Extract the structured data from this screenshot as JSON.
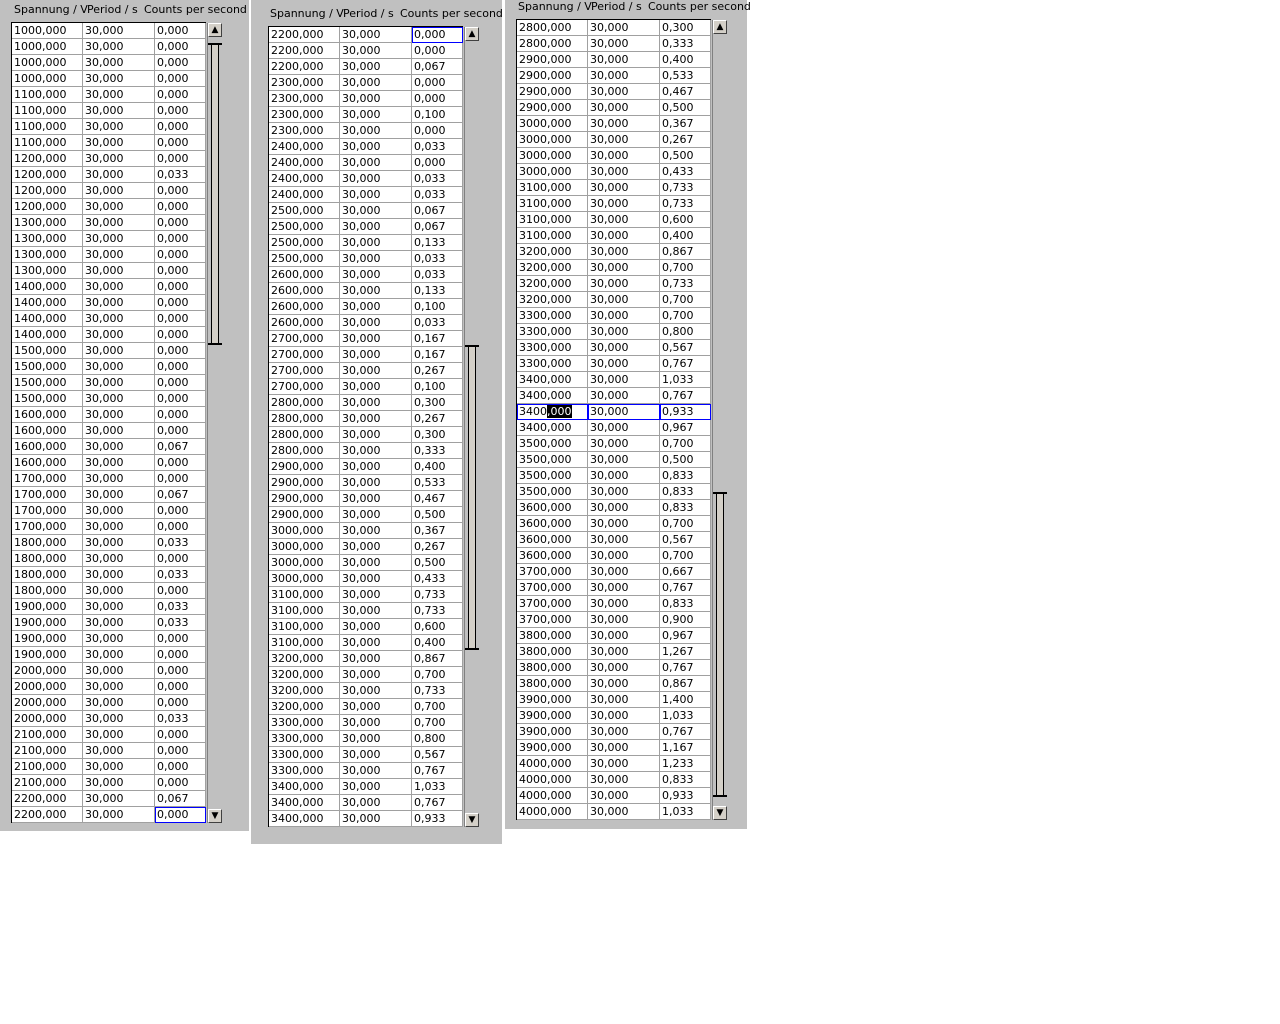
{
  "columns": [
    "Spannung / V",
    "Period / s",
    "Counts per second"
  ],
  "tables": [
    {
      "rows": [
        [
          "1000,000",
          "30,000",
          "0,000"
        ],
        [
          "1000,000",
          "30,000",
          "0,000"
        ],
        [
          "1000,000",
          "30,000",
          "0,000"
        ],
        [
          "1000,000",
          "30,000",
          "0,000"
        ],
        [
          "1100,000",
          "30,000",
          "0,000"
        ],
        [
          "1100,000",
          "30,000",
          "0,000"
        ],
        [
          "1100,000",
          "30,000",
          "0,000"
        ],
        [
          "1100,000",
          "30,000",
          "0,000"
        ],
        [
          "1200,000",
          "30,000",
          "0,000"
        ],
        [
          "1200,000",
          "30,000",
          "0,033"
        ],
        [
          "1200,000",
          "30,000",
          "0,000"
        ],
        [
          "1200,000",
          "30,000",
          "0,000"
        ],
        [
          "1300,000",
          "30,000",
          "0,000"
        ],
        [
          "1300,000",
          "30,000",
          "0,000"
        ],
        [
          "1300,000",
          "30,000",
          "0,000"
        ],
        [
          "1300,000",
          "30,000",
          "0,000"
        ],
        [
          "1400,000",
          "30,000",
          "0,000"
        ],
        [
          "1400,000",
          "30,000",
          "0,000"
        ],
        [
          "1400,000",
          "30,000",
          "0,000"
        ],
        [
          "1400,000",
          "30,000",
          "0,000"
        ],
        [
          "1500,000",
          "30,000",
          "0,000"
        ],
        [
          "1500,000",
          "30,000",
          "0,000"
        ],
        [
          "1500,000",
          "30,000",
          "0,000"
        ],
        [
          "1500,000",
          "30,000",
          "0,000"
        ],
        [
          "1600,000",
          "30,000",
          "0,000"
        ],
        [
          "1600,000",
          "30,000",
          "0,000"
        ],
        [
          "1600,000",
          "30,000",
          "0,067"
        ],
        [
          "1600,000",
          "30,000",
          "0,000"
        ],
        [
          "1700,000",
          "30,000",
          "0,000"
        ],
        [
          "1700,000",
          "30,000",
          "0,067"
        ],
        [
          "1700,000",
          "30,000",
          "0,000"
        ],
        [
          "1700,000",
          "30,000",
          "0,000"
        ],
        [
          "1800,000",
          "30,000",
          "0,033"
        ],
        [
          "1800,000",
          "30,000",
          "0,000"
        ],
        [
          "1800,000",
          "30,000",
          "0,033"
        ],
        [
          "1800,000",
          "30,000",
          "0,000"
        ],
        [
          "1900,000",
          "30,000",
          "0,033"
        ],
        [
          "1900,000",
          "30,000",
          "0,033"
        ],
        [
          "1900,000",
          "30,000",
          "0,000"
        ],
        [
          "1900,000",
          "30,000",
          "0,000"
        ],
        [
          "2000,000",
          "30,000",
          "0,000"
        ],
        [
          "2000,000",
          "30,000",
          "0,000"
        ],
        [
          "2000,000",
          "30,000",
          "0,000"
        ],
        [
          "2000,000",
          "30,000",
          "0,033"
        ],
        [
          "2100,000",
          "30,000",
          "0,000"
        ],
        [
          "2100,000",
          "30,000",
          "0,000"
        ],
        [
          "2100,000",
          "30,000",
          "0,000"
        ],
        [
          "2100,000",
          "30,000",
          "0,000"
        ],
        [
          "2200,000",
          "30,000",
          "0,067"
        ],
        [
          "2200,000",
          "30,000",
          "0,000"
        ]
      ],
      "selected_row": 49
    },
    {
      "rows": [
        [
          "2200,000",
          "30,000",
          "0,000"
        ],
        [
          "2200,000",
          "30,000",
          "0,000"
        ],
        [
          "2200,000",
          "30,000",
          "0,067"
        ],
        [
          "2300,000",
          "30,000",
          "0,000"
        ],
        [
          "2300,000",
          "30,000",
          "0,000"
        ],
        [
          "2300,000",
          "30,000",
          "0,100"
        ],
        [
          "2300,000",
          "30,000",
          "0,000"
        ],
        [
          "2400,000",
          "30,000",
          "0,033"
        ],
        [
          "2400,000",
          "30,000",
          "0,000"
        ],
        [
          "2400,000",
          "30,000",
          "0,033"
        ],
        [
          "2400,000",
          "30,000",
          "0,033"
        ],
        [
          "2500,000",
          "30,000",
          "0,067"
        ],
        [
          "2500,000",
          "30,000",
          "0,067"
        ],
        [
          "2500,000",
          "30,000",
          "0,133"
        ],
        [
          "2500,000",
          "30,000",
          "0,033"
        ],
        [
          "2600,000",
          "30,000",
          "0,033"
        ],
        [
          "2600,000",
          "30,000",
          "0,133"
        ],
        [
          "2600,000",
          "30,000",
          "0,100"
        ],
        [
          "2600,000",
          "30,000",
          "0,033"
        ],
        [
          "2700,000",
          "30,000",
          "0,167"
        ],
        [
          "2700,000",
          "30,000",
          "0,167"
        ],
        [
          "2700,000",
          "30,000",
          "0,267"
        ],
        [
          "2700,000",
          "30,000",
          "0,100"
        ],
        [
          "2800,000",
          "30,000",
          "0,300"
        ],
        [
          "2800,000",
          "30,000",
          "0,267"
        ],
        [
          "2800,000",
          "30,000",
          "0,300"
        ],
        [
          "2800,000",
          "30,000",
          "0,333"
        ],
        [
          "2900,000",
          "30,000",
          "0,400"
        ],
        [
          "2900,000",
          "30,000",
          "0,533"
        ],
        [
          "2900,000",
          "30,000",
          "0,467"
        ],
        [
          "2900,000",
          "30,000",
          "0,500"
        ],
        [
          "3000,000",
          "30,000",
          "0,367"
        ],
        [
          "3000,000",
          "30,000",
          "0,267"
        ],
        [
          "3000,000",
          "30,000",
          "0,500"
        ],
        [
          "3000,000",
          "30,000",
          "0,433"
        ],
        [
          "3100,000",
          "30,000",
          "0,733"
        ],
        [
          "3100,000",
          "30,000",
          "0,733"
        ],
        [
          "3100,000",
          "30,000",
          "0,600"
        ],
        [
          "3100,000",
          "30,000",
          "0,400"
        ],
        [
          "3200,000",
          "30,000",
          "0,867"
        ],
        [
          "3200,000",
          "30,000",
          "0,700"
        ],
        [
          "3200,000",
          "30,000",
          "0,733"
        ],
        [
          "3200,000",
          "30,000",
          "0,700"
        ],
        [
          "3300,000",
          "30,000",
          "0,700"
        ],
        [
          "3300,000",
          "30,000",
          "0,800"
        ],
        [
          "3300,000",
          "30,000",
          "0,567"
        ],
        [
          "3300,000",
          "30,000",
          "0,767"
        ],
        [
          "3400,000",
          "30,000",
          "1,033"
        ],
        [
          "3400,000",
          "30,000",
          "0,767"
        ],
        [
          "3400,000",
          "30,000",
          "0,933"
        ]
      ],
      "selected_row": 0
    },
    {
      "rows": [
        [
          "2800,000",
          "30,000",
          "0,300"
        ],
        [
          "2800,000",
          "30,000",
          "0,333"
        ],
        [
          "2900,000",
          "30,000",
          "0,400"
        ],
        [
          "2900,000",
          "30,000",
          "0,533"
        ],
        [
          "2900,000",
          "30,000",
          "0,467"
        ],
        [
          "2900,000",
          "30,000",
          "0,500"
        ],
        [
          "3000,000",
          "30,000",
          "0,367"
        ],
        [
          "3000,000",
          "30,000",
          "0,267"
        ],
        [
          "3000,000",
          "30,000",
          "0,500"
        ],
        [
          "3000,000",
          "30,000",
          "0,433"
        ],
        [
          "3100,000",
          "30,000",
          "0,733"
        ],
        [
          "3100,000",
          "30,000",
          "0,733"
        ],
        [
          "3100,000",
          "30,000",
          "0,600"
        ],
        [
          "3100,000",
          "30,000",
          "0,400"
        ],
        [
          "3200,000",
          "30,000",
          "0,867"
        ],
        [
          "3200,000",
          "30,000",
          "0,700"
        ],
        [
          "3200,000",
          "30,000",
          "0,733"
        ],
        [
          "3200,000",
          "30,000",
          "0,700"
        ],
        [
          "3300,000",
          "30,000",
          "0,700"
        ],
        [
          "3300,000",
          "30,000",
          "0,800"
        ],
        [
          "3300,000",
          "30,000",
          "0,567"
        ],
        [
          "3300,000",
          "30,000",
          "0,767"
        ],
        [
          "3400,000",
          "30,000",
          "1,033"
        ],
        [
          "3400,000",
          "30,000",
          "0,767"
        ],
        [
          "3400,000",
          "30,000",
          "0,933"
        ],
        [
          "3400,000",
          "30,000",
          "0,967"
        ],
        [
          "3500,000",
          "30,000",
          "0,700"
        ],
        [
          "3500,000",
          "30,000",
          "0,500"
        ],
        [
          "3500,000",
          "30,000",
          "0,833"
        ],
        [
          "3500,000",
          "30,000",
          "0,833"
        ],
        [
          "3600,000",
          "30,000",
          "0,833"
        ],
        [
          "3600,000",
          "30,000",
          "0,700"
        ],
        [
          "3600,000",
          "30,000",
          "0,567"
        ],
        [
          "3600,000",
          "30,000",
          "0,700"
        ],
        [
          "3700,000",
          "30,000",
          "0,667"
        ],
        [
          "3700,000",
          "30,000",
          "0,767"
        ],
        [
          "3700,000",
          "30,000",
          "0,833"
        ],
        [
          "3700,000",
          "30,000",
          "0,900"
        ],
        [
          "3800,000",
          "30,000",
          "0,967"
        ],
        [
          "3800,000",
          "30,000",
          "1,267"
        ],
        [
          "3800,000",
          "30,000",
          "0,767"
        ],
        [
          "3800,000",
          "30,000",
          "0,867"
        ],
        [
          "3900,000",
          "30,000",
          "1,400"
        ],
        [
          "3900,000",
          "30,000",
          "1,033"
        ],
        [
          "3900,000",
          "30,000",
          "0,767"
        ],
        [
          "3900,000",
          "30,000",
          "1,167"
        ],
        [
          "4000,000",
          "30,000",
          "1,233"
        ],
        [
          "4000,000",
          "30,000",
          "0,833"
        ],
        [
          "4000,000",
          "30,000",
          "0,933"
        ],
        [
          "4000,000",
          "30,000",
          "1,033"
        ]
      ],
      "selected_row": 24
    }
  ],
  "scroll_up_glyph": "▲",
  "scroll_down_glyph": "▼"
}
